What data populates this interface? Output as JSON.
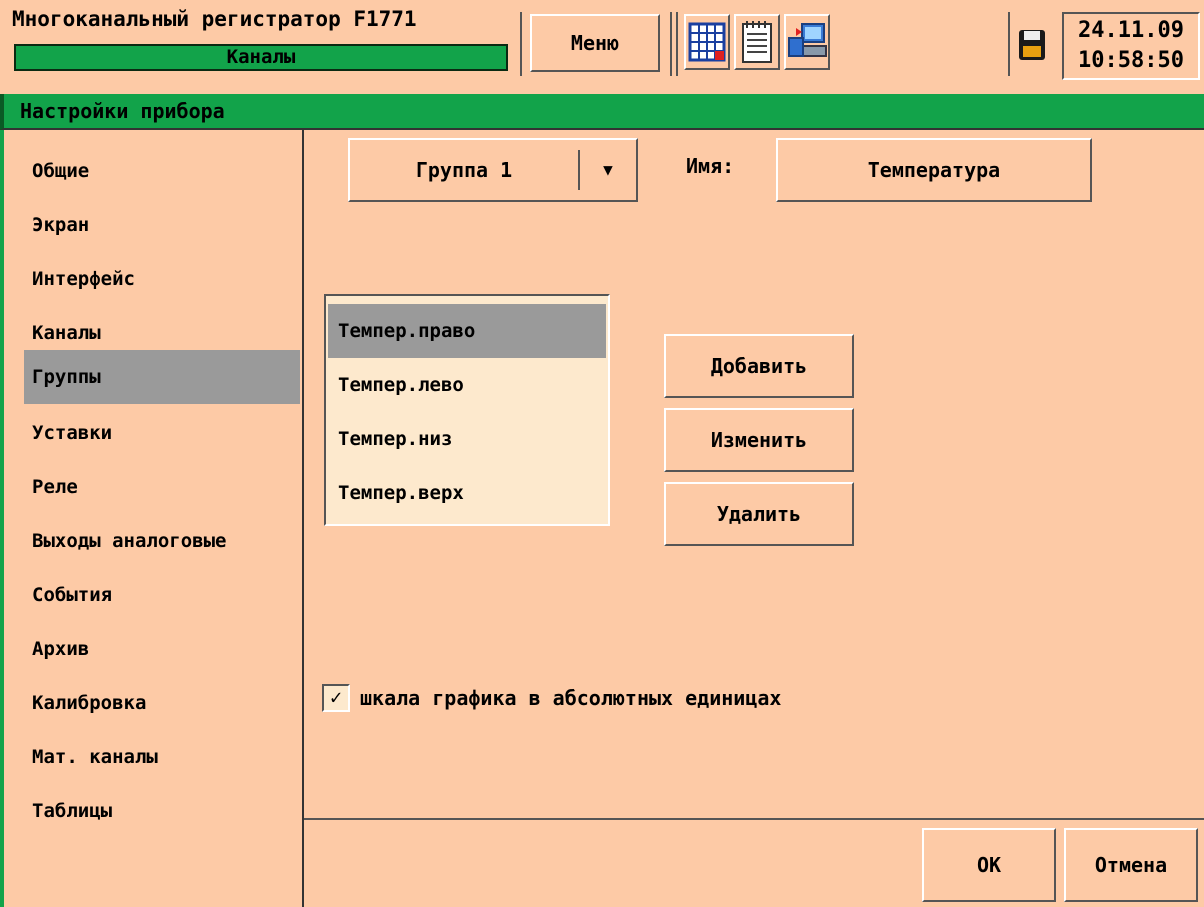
{
  "header": {
    "title": "Многоканальный регистратор F1771",
    "status": "Каналы",
    "menu_label": "Меню",
    "tools": [
      "grid-table-icon",
      "notepad-icon",
      "computer-transfer-icon"
    ],
    "storage_icon": "floppy-disk-icon",
    "date": "24.11.09",
    "time": "10:58:50"
  },
  "section": {
    "title": "Настройки прибора"
  },
  "sidebar": {
    "items": [
      {
        "label": "Общие"
      },
      {
        "label": "Экран"
      },
      {
        "label": "Интерфейс"
      },
      {
        "label": "Каналы"
      },
      {
        "label": "Группы"
      },
      {
        "label": "Уставки"
      },
      {
        "label": "Реле"
      },
      {
        "label": "Выходы аналоговые"
      },
      {
        "label": "События"
      },
      {
        "label": "Архив"
      },
      {
        "label": "Калибровка"
      },
      {
        "label": "Мат. каналы"
      },
      {
        "label": "Таблицы"
      }
    ],
    "active_index": 4
  },
  "main": {
    "group_select": {
      "value": "Группа 1"
    },
    "name_label": "Имя:",
    "name_value": "Температура",
    "channels": [
      {
        "label": "Темпер.право"
      },
      {
        "label": "Темпер.лево"
      },
      {
        "label": "Темпер.низ"
      },
      {
        "label": "Темпер.верх"
      }
    ],
    "selected_channel": 0,
    "buttons": {
      "add": "Добавить",
      "edit": "Изменить",
      "delete": "Удалить"
    },
    "checkbox": {
      "label": "шкала графика в абсолютных единицах",
      "checked": true
    }
  },
  "footer": {
    "ok": "OK",
    "cancel": "Отмена"
  },
  "colors": {
    "background": "#fdcaa6",
    "accent_green": "#12a34a",
    "selected_gray": "#9a9a9a",
    "list_background": "#fde9cd"
  }
}
